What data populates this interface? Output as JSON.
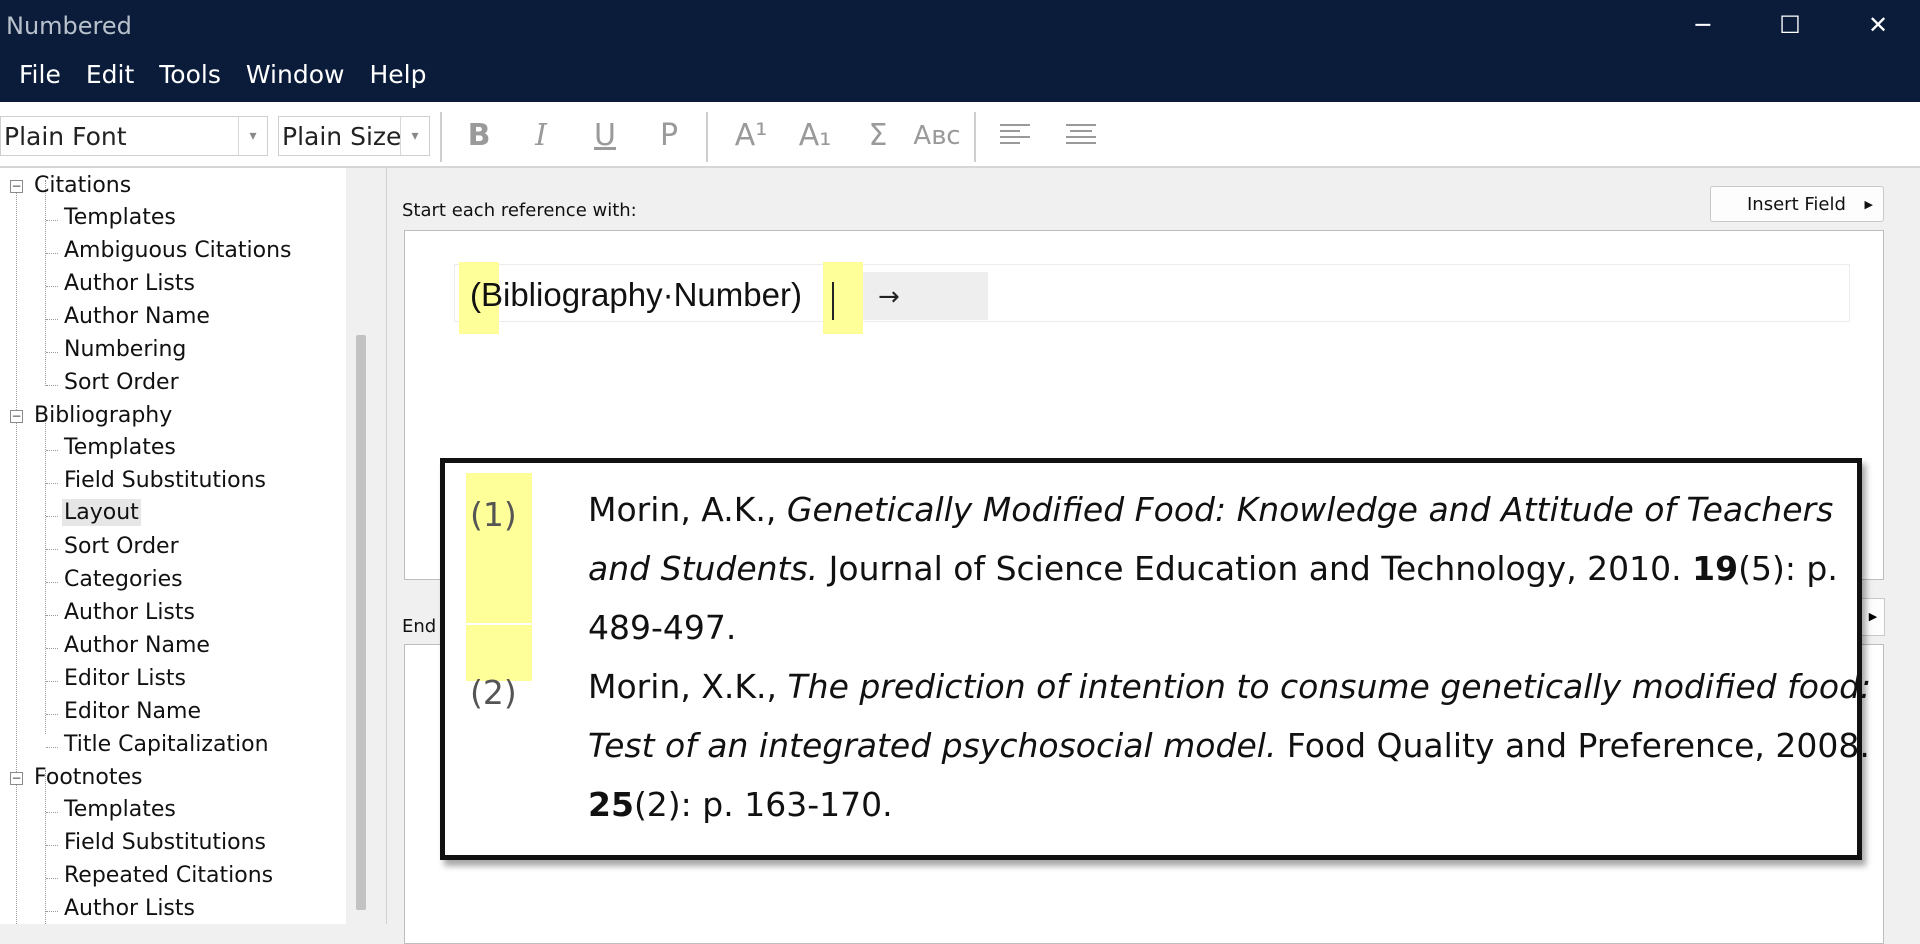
{
  "window": {
    "title": "Numbered",
    "controls": {
      "minimize": "─",
      "maximize": "☐",
      "close": "✕"
    }
  },
  "menu": [
    "File",
    "Edit",
    "Tools",
    "Window",
    "Help"
  ],
  "toolbar": {
    "font_value": "Plain Font",
    "size_value": "Plain Size",
    "buttons": {
      "bold": "B",
      "italic": "I",
      "underline": "U",
      "plain": "P",
      "superscript": "A¹",
      "subscript": "A₁",
      "symbol": "Σ",
      "small_caps": "Aʙᴄ"
    }
  },
  "tree": {
    "citations": {
      "label": "Citations",
      "items": [
        "Templates",
        "Ambiguous Citations",
        "Author Lists",
        "Author Name",
        "Numbering",
        "Sort Order"
      ]
    },
    "bibliography": {
      "label": "Bibliography",
      "items": [
        "Templates",
        "Field Substitutions",
        "Layout",
        "Sort Order",
        "Categories",
        "Author Lists",
        "Author Name",
        "Editor Lists",
        "Editor Name",
        "Title Capitalization"
      ]
    },
    "footnotes": {
      "label": "Footnotes",
      "items": [
        "Templates",
        "Field Substitutions",
        "Repeated Citations",
        "Author Lists"
      ]
    },
    "selected": "Layout"
  },
  "main": {
    "start_label": "Start each reference with:",
    "insert_field_label": "Insert Field",
    "start_value": "(Bibliography·Number)",
    "tab_arrow": "→",
    "end_label": "End"
  },
  "preview": {
    "entries": [
      {
        "number": "(1)",
        "line1_author": "Morin, A.K., ",
        "line1_title": "Genetically Modified Food: Knowledge and Attitude of Teachers",
        "line2_title": "and Students.",
        "line2_rest": " Journal of Science Education and Technology, 2010. ",
        "line2_volume": "19",
        "line2_issue": "(5): p.",
        "line3": "489-497."
      },
      {
        "number": "(2)",
        "line1_author": "Morin, X.K., ",
        "line1_title": "The prediction of intention to consume genetically modified food:",
        "line2_title": "Test of an integrated psychosocial model.",
        "line2_rest": " Food Quality and Preference, 2008.",
        "line3_volume": "25",
        "line3_rest": "(2): p. 163-170."
      }
    ],
    "highlight_color": "#ffff99"
  }
}
